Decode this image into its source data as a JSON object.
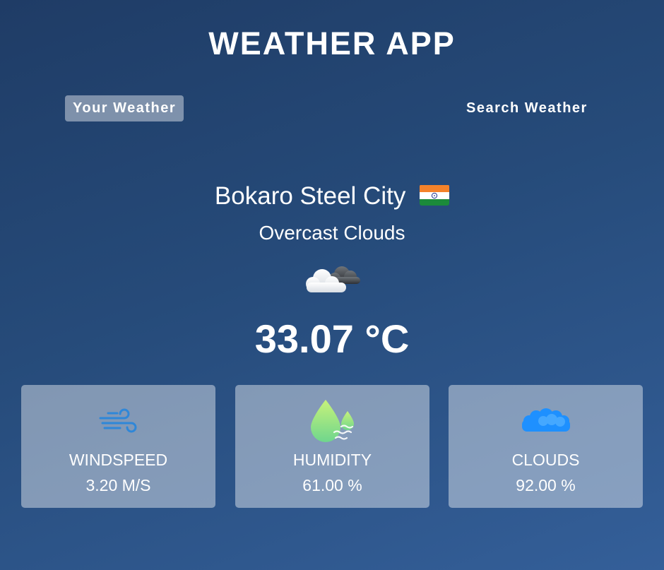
{
  "header": {
    "title": "WEATHER APP"
  },
  "tabs": [
    {
      "label": "Your Weather",
      "active": true
    },
    {
      "label": "Search Weather",
      "active": false
    }
  ],
  "weather": {
    "city": "Bokaro Steel City",
    "country_flag_icon": "india-flag-icon",
    "description": "Overcast Clouds",
    "condition_icon": "overcast-clouds-icon",
    "temperature": "33.07 °C"
  },
  "stats": [
    {
      "icon": "wind-icon",
      "label": "WINDSPEED",
      "value": "3.20 M/S"
    },
    {
      "icon": "humidity-icon",
      "label": "HUMIDITY",
      "value": "61.00 %"
    },
    {
      "icon": "clouds-icon",
      "label": "CLOUDS",
      "value": "92.00 %"
    }
  ],
  "colors": {
    "background_top": "#1f3c66",
    "background_bottom": "#345f99",
    "wind_icon": "#2f87d8",
    "humidity_icon": "#9be17a",
    "clouds_icon": "#1e90ff"
  }
}
